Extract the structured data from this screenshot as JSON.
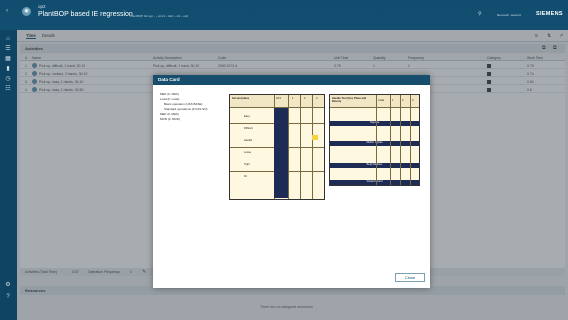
{
  "header": {
    "app_short": "op2",
    "title": "PlantBOP based IE regression",
    "breadcrumbs": [
      "PlantBOP IE regr...",
      "proc1",
      "leb1",
      "st1",
      "op2"
    ],
    "account": "Neo-tech, second",
    "brand": "SIEMENS"
  },
  "tabs": [
    {
      "label": "Time"
    },
    {
      "label": "Details"
    }
  ],
  "activities": {
    "title": "Activities",
    "columns": [
      "#",
      "Name",
      "Activity Description",
      "Code",
      "Unit Time",
      "Quantity",
      "Frequency",
      "Category",
      "Work Time"
    ],
    "rows": [
      {
        "num": "1",
        "name": "Pick up, difficult, 1 hand, 30-10",
        "desc": "Pick up, difficult, 1 hand, 30-10",
        "code": "2000-0174-4",
        "unit": "0.75",
        "qty": "1",
        "freq": "1",
        "work": "0.79"
      },
      {
        "num": "2",
        "name": "Pick up, contact, 2 hands, 30-10",
        "desc": "",
        "code": "",
        "unit": "",
        "qty": "",
        "freq": "",
        "work": "0.74"
      },
      {
        "num": "3",
        "name": "Pick up, easy, 1 hands, 30-10",
        "desc": "",
        "code": "",
        "unit": "",
        "qty": "",
        "freq": "",
        "work": "0.60"
      },
      {
        "num": "4",
        "name": "Pick up, easy, 1 hands, 30-50",
        "desc": "",
        "code": "",
        "unit": "",
        "qty": "",
        "freq": "",
        "work": "0.6"
      }
    ]
  },
  "bottom_tools": {
    "activities_label": "Activities (Total Time)",
    "total": "0.87",
    "op_freq_label": "Operation Frequency",
    "op_freq": "1"
  },
  "resources": {
    "title": "Resources",
    "empty": "There are no assigned resources"
  },
  "dialog": {
    "title": "Data Card",
    "tree": [
      "MEK (F. MEK)",
      "Load (F. Load)",
      "Basic operation (UAS BASE)",
      "Standard operations (F.UAS SO)",
      "MEK (F. MEK)",
      "MOD (F. MOD)"
    ],
    "close_label": "Close",
    "left_card": {
      "header": [
        "Get and place",
        "GF1",
        "1",
        "2",
        "3"
      ],
      "cells": [
        "Easy",
        "Difficult",
        "Handle",
        "Loose",
        "Tight",
        "Fit"
      ]
    },
    "right_card": {
      "header": [
        "Handle Tool (Get, Place and Return)",
        "Code",
        "1",
        "2",
        "3"
      ],
      "sections": [
        "Operate",
        "Motion Cycles",
        "Body Motions",
        "Visual Control"
      ]
    }
  }
}
